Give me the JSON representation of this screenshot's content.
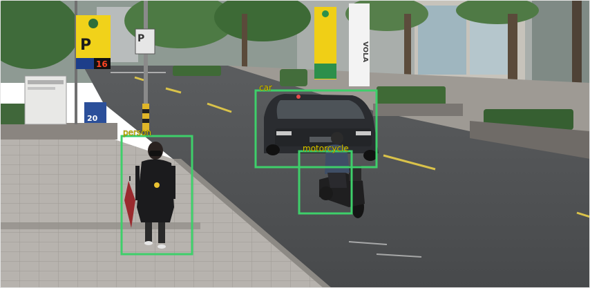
{
  "scene": {
    "description_tag": "street-camera-object-detection",
    "box_color": "#3ecf6a",
    "label_color": "#d6c200"
  },
  "detections": [
    {
      "label": "person"
    },
    {
      "label": "car"
    },
    {
      "label": "motorcycle"
    }
  ],
  "signs": {
    "parking_letter": "P",
    "parking_number": "16",
    "blue_sign_number": "20",
    "vertical_store_sign": "VOLA"
  }
}
